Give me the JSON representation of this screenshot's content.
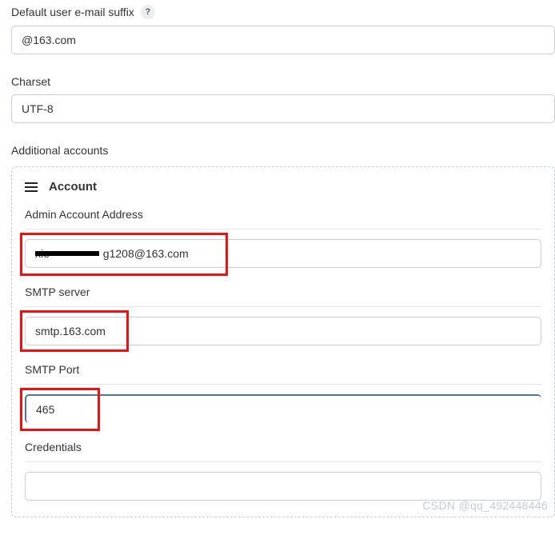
{
  "fields": {
    "default_suffix": {
      "label": "Default user e-mail suffix",
      "value": "@163.com"
    },
    "charset": {
      "label": "Charset",
      "value": "UTF-8"
    }
  },
  "additional_accounts": {
    "heading": "Additional accounts",
    "account": {
      "title": "Account",
      "admin_address": {
        "label": "Admin Account Address",
        "value_visible": "g1208@163.com",
        "value_redacted_prefix": "xie"
      },
      "smtp_server": {
        "label": "SMTP server",
        "value": "smtp.163.com"
      },
      "smtp_port": {
        "label": "SMTP Port",
        "value": "465"
      },
      "credentials": {
        "label": "Credentials",
        "value": ""
      }
    }
  },
  "watermark": "CSDN @qq_492448446"
}
